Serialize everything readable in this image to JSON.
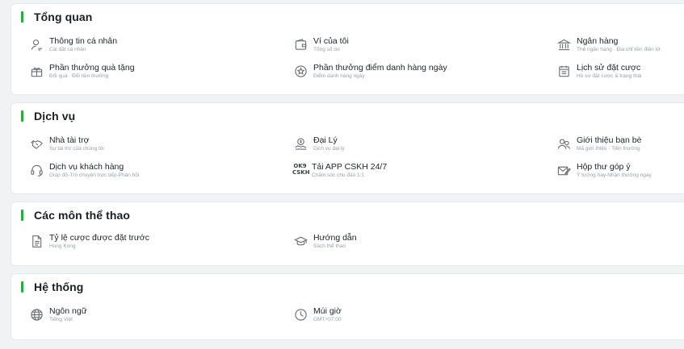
{
  "sections": [
    {
      "title": "Tổng quan",
      "items": [
        {
          "label": "Thông tin cá nhân",
          "sub": "Cài đặt cá nhân",
          "icon": "user-icon"
        },
        {
          "label": "Ví của tôi",
          "sub": "Tổng số dư",
          "icon": "wallet-icon"
        },
        {
          "label": "Ngân hàng",
          "sub": "Thẻ ngân hàng · Địa chỉ tiền điện tử",
          "icon": "bank-icon"
        },
        {
          "label": "Phần thưởng quà tặng",
          "sub": "Đổi quà · Đổi tiền thưởng",
          "icon": "gift-icon"
        },
        {
          "label": "Phần thưởng điểm danh hàng ngày",
          "sub": "Điểm danh hàng ngày",
          "icon": "star-badge-icon"
        },
        {
          "label": "Lịch sử đặt cược",
          "sub": "Hồ sơ đặt cược & trạng thái",
          "icon": "receipt-icon"
        }
      ]
    },
    {
      "title": "Dịch vụ",
      "items": [
        {
          "label": "Nhà tài trợ",
          "sub": "Sự tài trợ của chúng tôi",
          "icon": "handshake-icon"
        },
        {
          "label": "Đại Lý",
          "sub": "Dịch vụ đại lý",
          "icon": "agent-icon"
        },
        {
          "label": "Giới thiệu bạn bè",
          "sub": "Mã giới thiệu · Tiền thưởng",
          "icon": "friends-icon"
        },
        {
          "label": "Dịch vụ khách hàng",
          "sub": "Giúp đỡ-Trò chuyện trực tiếp-Phản hồi",
          "icon": "headset-icon"
        },
        {
          "label": "Tải APP CSKH 24/7",
          "sub": "Chăm sóc chu đáo 1:1",
          "icon": "ok9-cskh-logo"
        },
        {
          "label": "Hộp thư góp ý",
          "sub": "Ý tưởng hay-Nhận thưởng ngay",
          "icon": "mail-edit-icon"
        }
      ]
    },
    {
      "title": "Các môn thể thao",
      "items": [
        {
          "label": "Tỷ lệ cược được đặt trước",
          "sub": "Hong Kong",
          "icon": "document-icon"
        },
        {
          "label": "Hướng dẫn",
          "sub": "Sách thể thao",
          "icon": "graduation-cap-icon"
        }
      ]
    },
    {
      "title": "Hệ thống",
      "items": [
        {
          "label": "Ngôn ngữ",
          "sub": "Tiếng Việt",
          "icon": "globe-icon"
        },
        {
          "label": "Múi giờ",
          "sub": "GMT+07:00",
          "icon": "clock-icon"
        }
      ]
    }
  ],
  "logo_text": {
    "line1": "OK9",
    "line2": "CSKH"
  },
  "colors": {
    "accent": "#2eaa3f",
    "card_bg": "#ffffff",
    "page_bg": "#f1f2f4"
  }
}
